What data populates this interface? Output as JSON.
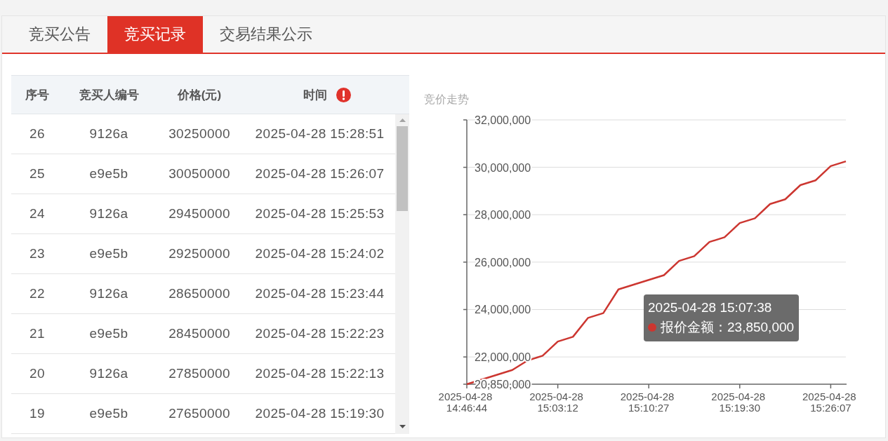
{
  "tabs": [
    {
      "label": "竞买公告",
      "selected": false
    },
    {
      "label": "竞买记录",
      "selected": true
    },
    {
      "label": "交易结果公示",
      "selected": false
    }
  ],
  "table": {
    "columns": [
      "序号",
      "竞买人编号",
      "价格(元)",
      "时间"
    ],
    "rows": [
      [
        "26",
        "9126a",
        "30250000",
        "2025-04-28 15:28:51"
      ],
      [
        "25",
        "e9e5b",
        "30050000",
        "2025-04-28 15:26:07"
      ],
      [
        "24",
        "9126a",
        "29450000",
        "2025-04-28 15:25:53"
      ],
      [
        "23",
        "e9e5b",
        "29250000",
        "2025-04-28 15:24:02"
      ],
      [
        "22",
        "9126a",
        "28650000",
        "2025-04-28 15:23:44"
      ],
      [
        "21",
        "e9e5b",
        "28450000",
        "2025-04-28 15:22:23"
      ],
      [
        "20",
        "9126a",
        "27850000",
        "2025-04-28 15:22:13"
      ],
      [
        "19",
        "e9e5b",
        "27650000",
        "2025-04-28 15:19:30"
      ]
    ]
  },
  "chart": {
    "chart_data": {
      "type": "line",
      "title": "竞价走势",
      "grid": true,
      "categories": [
        "2025-04-28 14:46:44",
        null,
        null,
        null,
        null,
        null,
        "2025-04-28 15:03:12",
        null,
        null,
        null,
        null,
        null,
        "2025-04-28 15:10:27",
        null,
        null,
        null,
        null,
        null,
        "2025-04-28 15:19:30",
        null,
        null,
        null,
        null,
        null,
        "2025-04-28 15:26:07",
        null
      ],
      "series": [
        {
          "color": "#cc3630",
          "values": [
            20850000,
            21050000,
            21250000,
            21450000,
            21850000,
            22050000,
            22650000,
            22850000,
            23650000,
            23850000,
            24850000,
            25050000,
            25250000,
            25450000,
            26050000,
            26250000,
            26850000,
            27050000,
            27650000,
            27850000,
            28450000,
            28650000,
            29250000,
            29450000,
            30050000,
            30250000
          ]
        }
      ],
      "ylim": [
        20850000,
        32000000
      ],
      "yticks": [
        {
          "value": 20850000,
          "label": "20,850,000"
        },
        {
          "value": 22000000,
          "label": "22,000,000"
        },
        {
          "value": 24000000,
          "label": "24,000,000"
        },
        {
          "value": 26000000,
          "label": "26,000,000"
        },
        {
          "value": 28000000,
          "label": "28,000,000"
        },
        {
          "value": 30000000,
          "label": "30,000,000"
        },
        {
          "value": 32000000,
          "label": "32,000,000"
        }
      ]
    },
    "tooltip": {
      "title": "2025-04-28 15:07:38",
      "text": "报价金额：23,850,000"
    }
  }
}
